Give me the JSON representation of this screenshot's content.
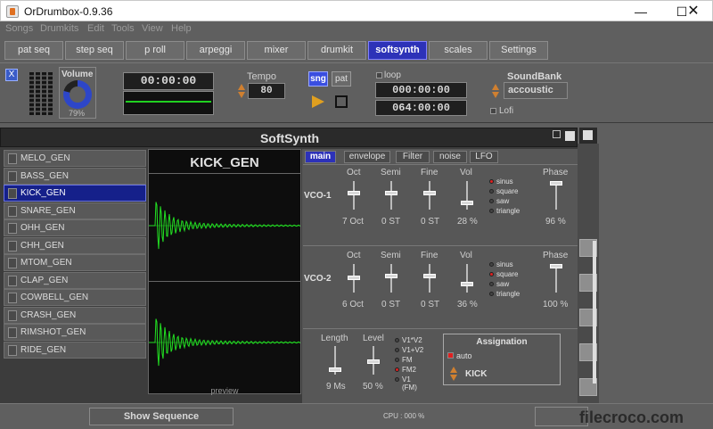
{
  "window": {
    "title": "OrDrumbox-0.9.36"
  },
  "menu": [
    "Songs",
    "Drumkits",
    "Edit",
    "Tools",
    "View",
    "Help"
  ],
  "tabs": [
    "pat seq",
    "step seq",
    "p roll",
    "arpeggi",
    "mixer",
    "drumkit",
    "softsynth",
    "scales",
    "Settings"
  ],
  "active_tab": "softsynth",
  "control": {
    "close_x": "X",
    "volume": {
      "label": "Volume",
      "value": "79%"
    },
    "time_display": "00:00:00",
    "tempo": {
      "label": "Tempo",
      "value": "80"
    },
    "mode_buttons": [
      "sng",
      "pat"
    ],
    "loop_label": "loop",
    "loop_time1": "000:00:00",
    "loop_time2": "064:00:00",
    "soundbank": {
      "label": "SoundBank",
      "value": "accoustic"
    },
    "lofi_label": "Lofi"
  },
  "softsynth": {
    "title": "SoftSynth",
    "generators": [
      "MELO_GEN",
      "BASS_GEN",
      "KICK_GEN",
      "SNARE_GEN",
      "OHH_GEN",
      "CHH_GEN",
      "MTOM_GEN",
      "CLAP_GEN",
      "COWBELL_GEN",
      "CRASH_GEN",
      "RIMSHOT_GEN",
      "RIDE_GEN"
    ],
    "selected_generator": "KICK_GEN",
    "wave_title": "KICK_GEN",
    "preview_label": "preview",
    "subtabs": [
      "main",
      "envelope",
      "Filter",
      "noise",
      "LFO"
    ],
    "vco_headers": [
      "Oct",
      "Semi",
      "Fine",
      "Vol",
      "Phase"
    ],
    "wave_options": [
      "sinus",
      "square",
      "saw",
      "triangle"
    ],
    "vco1": {
      "label": "VCO-1",
      "oct": "7 Oct",
      "semi": "0 ST",
      "fine": "0 ST",
      "vol": "28 %",
      "phase": "96 %",
      "wave": "sinus"
    },
    "vco2": {
      "label": "VCO-2",
      "oct": "6 Oct",
      "semi": "0 ST",
      "fine": "0 ST",
      "vol": "36 %",
      "phase": "100 %",
      "wave": "square"
    },
    "length": {
      "label": "Length",
      "value": "9 Ms"
    },
    "level": {
      "label": "Level",
      "value": "50 %"
    },
    "mix_options": [
      "V1*V2",
      "V1+V2",
      "FM",
      "FM2",
      "V1 (FM)"
    ],
    "mix_selected": "FM2",
    "assignation": {
      "title": "Assignation",
      "auto_label": "auto",
      "value": "KICK"
    }
  },
  "status": {
    "show_sequence": "Show Sequence",
    "cpu": "CPU : 000 %"
  },
  "watermark": "filecroco.com"
}
